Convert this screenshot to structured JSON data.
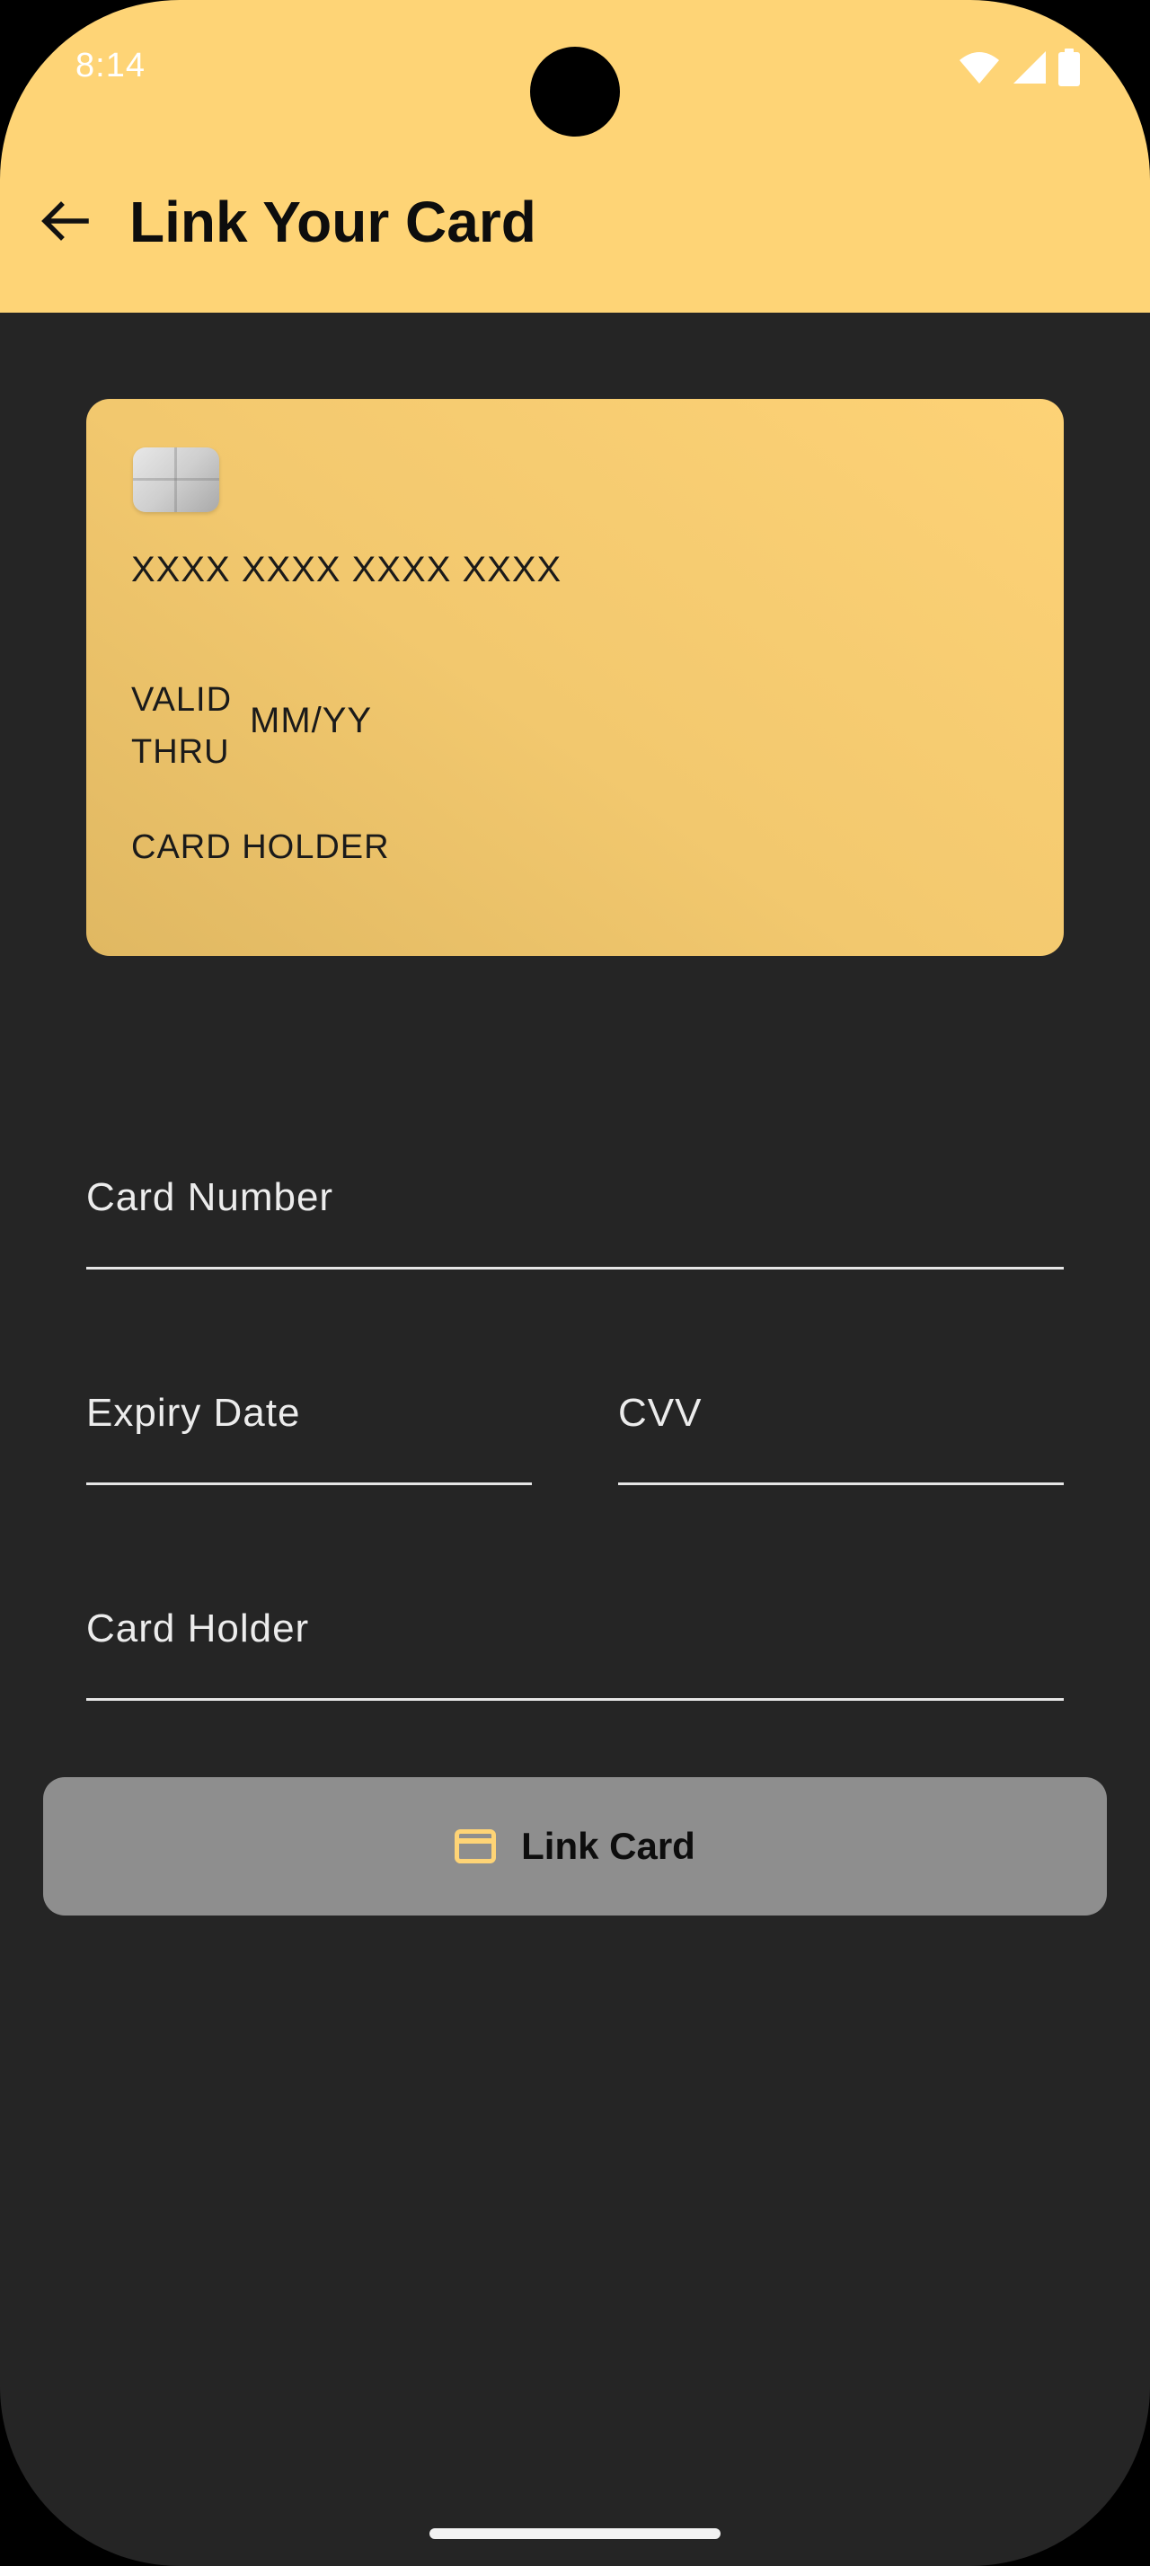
{
  "status_bar": {
    "time": "8:14",
    "icons": [
      "wifi-icon",
      "cellular-signal-icon",
      "battery-icon"
    ]
  },
  "app_bar": {
    "back_icon": "arrow-back-icon",
    "title": "Link Your Card"
  },
  "card_preview": {
    "chip_icon": "card-chip-icon",
    "number": "XXXX XXXX XXXX XXXX",
    "valid_thru_label": "VALID THRU",
    "expiry": "MM/YY",
    "holder": "CARD HOLDER"
  },
  "form": {
    "card_number_label": "Card Number",
    "expiry_label": "Expiry Date",
    "cvv_label": "CVV",
    "holder_label": "Card Holder"
  },
  "link_button": {
    "icon": "credit-card-icon",
    "label": "Link Card"
  },
  "colors": {
    "app_bar": "#FED476",
    "background": "#252525",
    "card_gold": "#F2C86E",
    "button_disabled": "#8E8E8E",
    "field_underline": "#E6E6E6",
    "card_icon_accent": "#FED476"
  }
}
